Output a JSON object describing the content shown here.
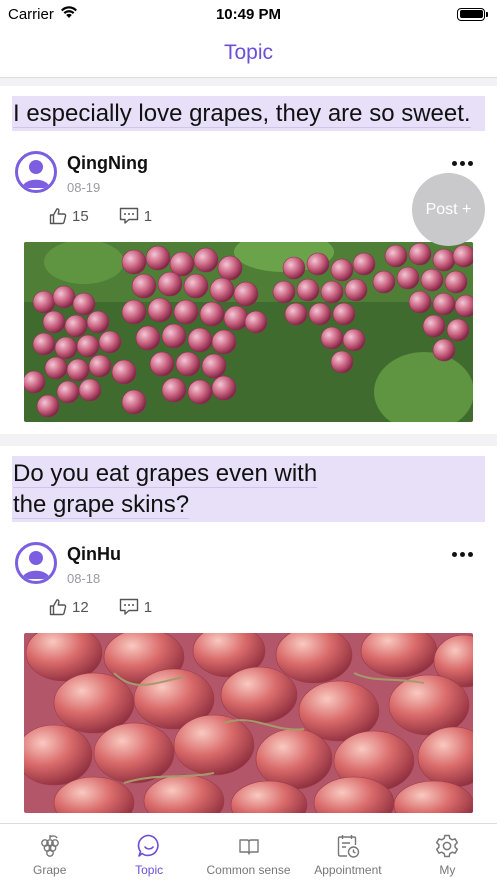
{
  "status_bar": {
    "carrier": "Carrier",
    "time": "10:49 PM"
  },
  "nav": {
    "title": "Topic"
  },
  "fab": {
    "label": "Post +"
  },
  "posts": [
    {
      "title": "I especially love grapes, they are so sweet.",
      "author": "QingNing",
      "date": "08-19",
      "likes": "15",
      "comments": "1",
      "image": "red-grape-bunches-on-vine"
    },
    {
      "title": "Do you eat grapes even with the grape skins?",
      "author": "QinHu",
      "date": "08-18",
      "likes": "12",
      "comments": "1",
      "image": "red-grapes-closeup"
    }
  ],
  "tabs": [
    {
      "label": "Grape",
      "icon": "grape-icon",
      "active": false
    },
    {
      "label": "Topic",
      "icon": "chat-bubble-icon",
      "active": true
    },
    {
      "label": "Common sense",
      "icon": "book-icon",
      "active": false
    },
    {
      "label": "Appointment",
      "icon": "calendar-clock-icon",
      "active": false
    },
    {
      "label": "My",
      "icon": "gear-icon",
      "active": false
    }
  ],
  "colors": {
    "accent": "#6b4fd8",
    "title_highlight": "#e8e0f8",
    "fab": "#c9c9cb"
  }
}
